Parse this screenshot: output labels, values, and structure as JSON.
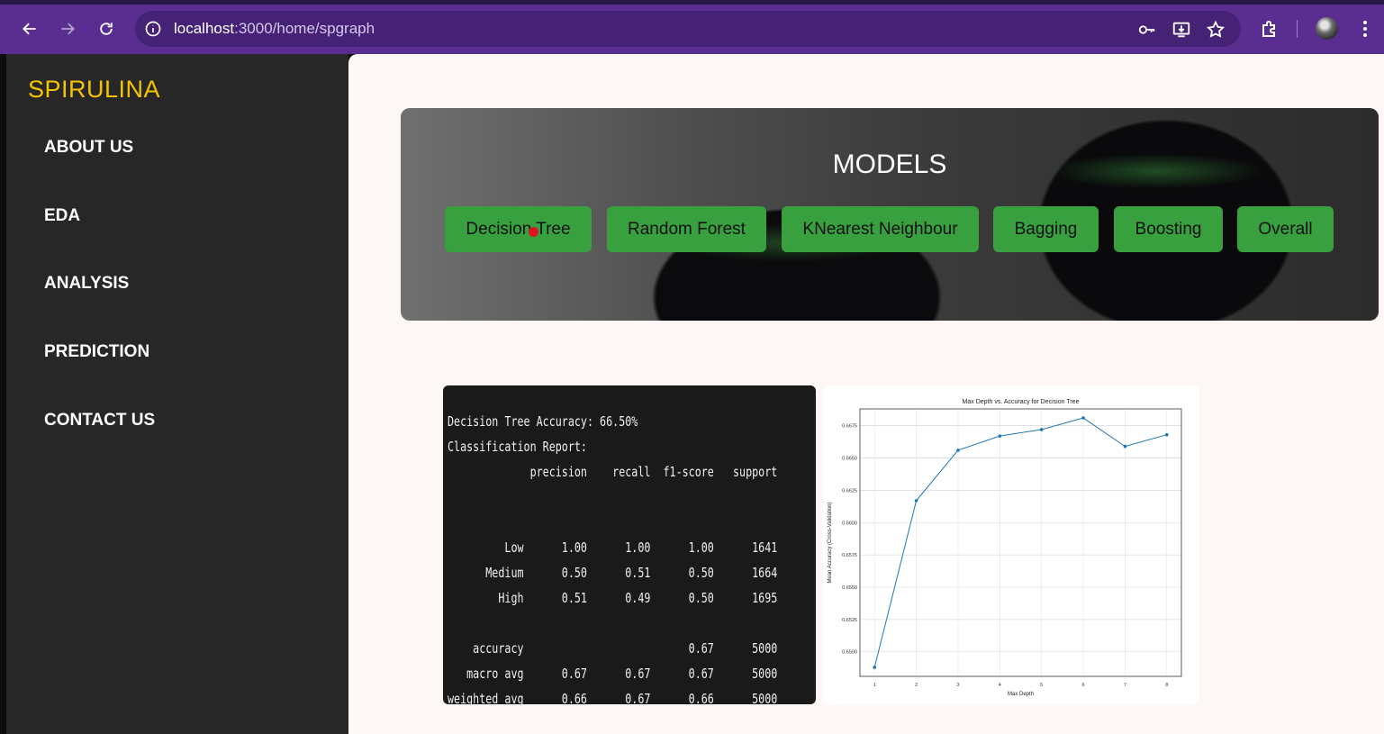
{
  "browser": {
    "url_host": "localhost",
    "url_rest": ":3000/home/spgraph"
  },
  "sidebar": {
    "brand": "SPIRULINA",
    "items": [
      {
        "label": "ABOUT US"
      },
      {
        "label": "EDA"
      },
      {
        "label": "ANALYSIS"
      },
      {
        "label": "PREDICTION"
      },
      {
        "label": "CONTACT US"
      }
    ]
  },
  "hero": {
    "title": "MODELS",
    "buttons": [
      {
        "label": "Decision Tree"
      },
      {
        "label": "Random Forest"
      },
      {
        "label": "KNearest Neighbour"
      },
      {
        "label": "Bagging"
      },
      {
        "label": "Boosting"
      },
      {
        "label": "Overall"
      }
    ]
  },
  "report": {
    "accuracy_line": "Decision Tree Accuracy: 66.50%",
    "heading": "Classification Report:",
    "columns": [
      "precision",
      "recall",
      "f1-score",
      "support"
    ],
    "rows": [
      {
        "label": "Low",
        "values": [
          "1.00",
          "1.00",
          "1.00",
          "1641"
        ]
      },
      {
        "label": "Medium",
        "values": [
          "0.50",
          "0.51",
          "0.50",
          "1664"
        ]
      },
      {
        "label": "High",
        "values": [
          "0.51",
          "0.49",
          "0.50",
          "1695"
        ]
      }
    ],
    "summary": [
      {
        "label": "accuracy",
        "values": [
          "",
          "",
          "0.67",
          "5000"
        ]
      },
      {
        "label": "macro avg",
        "values": [
          "0.67",
          "0.67",
          "0.67",
          "5000"
        ]
      },
      {
        "label": "weighted avg",
        "values": [
          "0.66",
          "0.67",
          "0.66",
          "5000"
        ]
      }
    ]
  },
  "colors": {
    "browser_bar": "#5a2d91",
    "sidebar_bg": "#272727",
    "brand": "#f5c400",
    "button_green": "#39a040",
    "line": "#1f77b4"
  },
  "chart_data": {
    "type": "line",
    "title": "Max Depth vs. Accuracy for Decision Tree",
    "xlabel": "Max Depth",
    "ylabel": "Mean Accuracy (Cross-Validation)",
    "x": [
      1,
      2,
      3,
      4,
      5,
      6,
      7,
      8
    ],
    "series": [
      {
        "values": [
          0.6488,
          0.6617,
          0.6656,
          0.6667,
          0.6672,
          0.6681,
          0.6659,
          0.6668
        ]
      }
    ],
    "xlim": [
      0.65,
      8.35
    ],
    "ylim": [
      0.6481,
      0.6688
    ],
    "xticks": [
      "1",
      "2",
      "3",
      "4",
      "5",
      "6",
      "7",
      "8"
    ],
    "yticks": [
      "0.6500",
      "0.6525",
      "0.6550",
      "0.6575",
      "0.6600",
      "0.6625",
      "0.6650",
      "0.6675"
    ],
    "ytick_values": [
      0.65,
      0.6525,
      0.655,
      0.6575,
      0.66,
      0.6625,
      0.665,
      0.6675
    ],
    "grid": true
  }
}
